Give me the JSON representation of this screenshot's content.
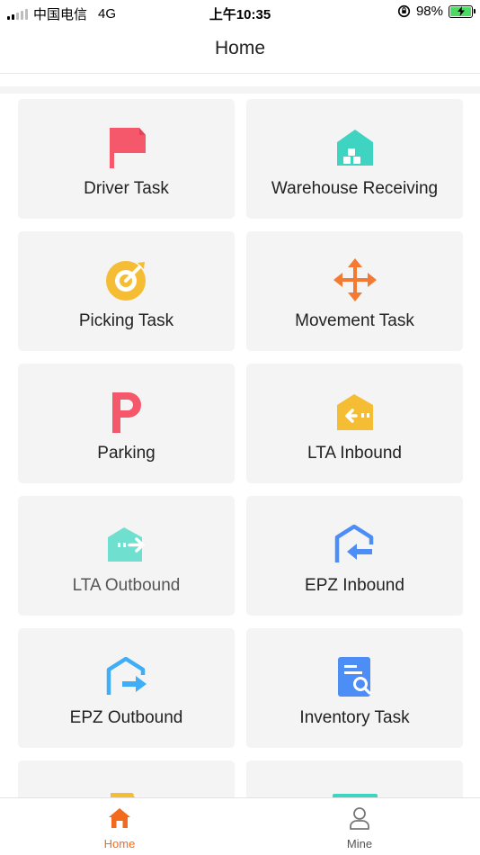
{
  "status_bar": {
    "carrier": "中国电信",
    "network": "4G",
    "time": "上午10:35",
    "battery": "98%"
  },
  "header": {
    "title": "Home"
  },
  "tiles": [
    {
      "label": "Driver Task",
      "icon": "flag-icon"
    },
    {
      "label": "Warehouse Receiving",
      "icon": "warehouse-icon"
    },
    {
      "label": "Picking Task",
      "icon": "target-icon"
    },
    {
      "label": "Movement Task",
      "icon": "move-arrows-icon"
    },
    {
      "label": "Parking",
      "icon": "parking-icon"
    },
    {
      "label": "LTA Inbound",
      "icon": "lta-inbound-icon"
    },
    {
      "label": "LTA Outbound",
      "icon": "lta-outbound-icon"
    },
    {
      "label": "EPZ Inbound",
      "icon": "epz-inbound-icon"
    },
    {
      "label": "EPZ Outbound",
      "icon": "epz-outbound-icon"
    },
    {
      "label": "Inventory Task",
      "icon": "inventory-search-icon"
    }
  ],
  "tab_bar": {
    "home_label": "Home",
    "mine_label": "Mine",
    "active_color": "#f26b1d",
    "inactive_color": "#555555"
  },
  "colors": {
    "red": "#f5586a",
    "teal": "#3fd4c2",
    "yellow": "#f4bd33",
    "orange": "#f47a33",
    "blue": "#4d8ef6",
    "sky": "#3faef6"
  }
}
